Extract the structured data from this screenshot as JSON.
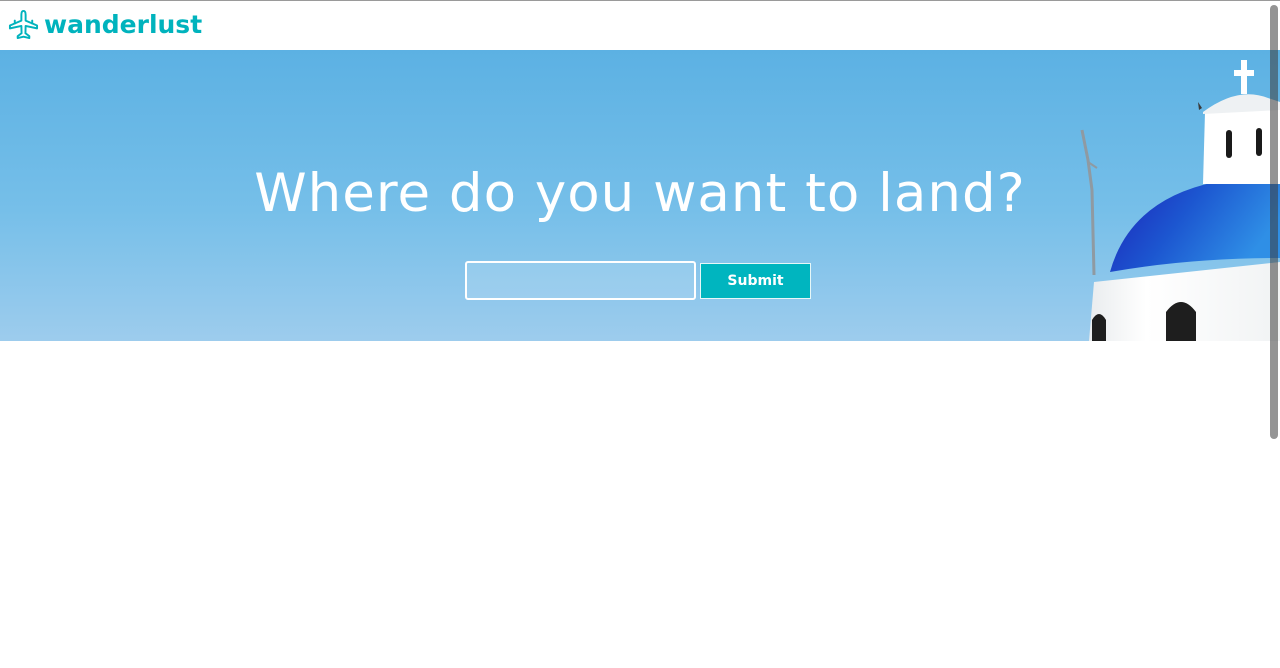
{
  "brand": {
    "name": "wanderlust",
    "icon": "airplane-icon",
    "color": "#00b3bd"
  },
  "hero": {
    "title": "Where do you want to land?",
    "search": {
      "value": "",
      "placeholder": ""
    },
    "submit_label": "Submit"
  },
  "colors": {
    "accent": "#00b5bf",
    "sky": "#6fbbe8",
    "dome": "#1a5fd6"
  }
}
